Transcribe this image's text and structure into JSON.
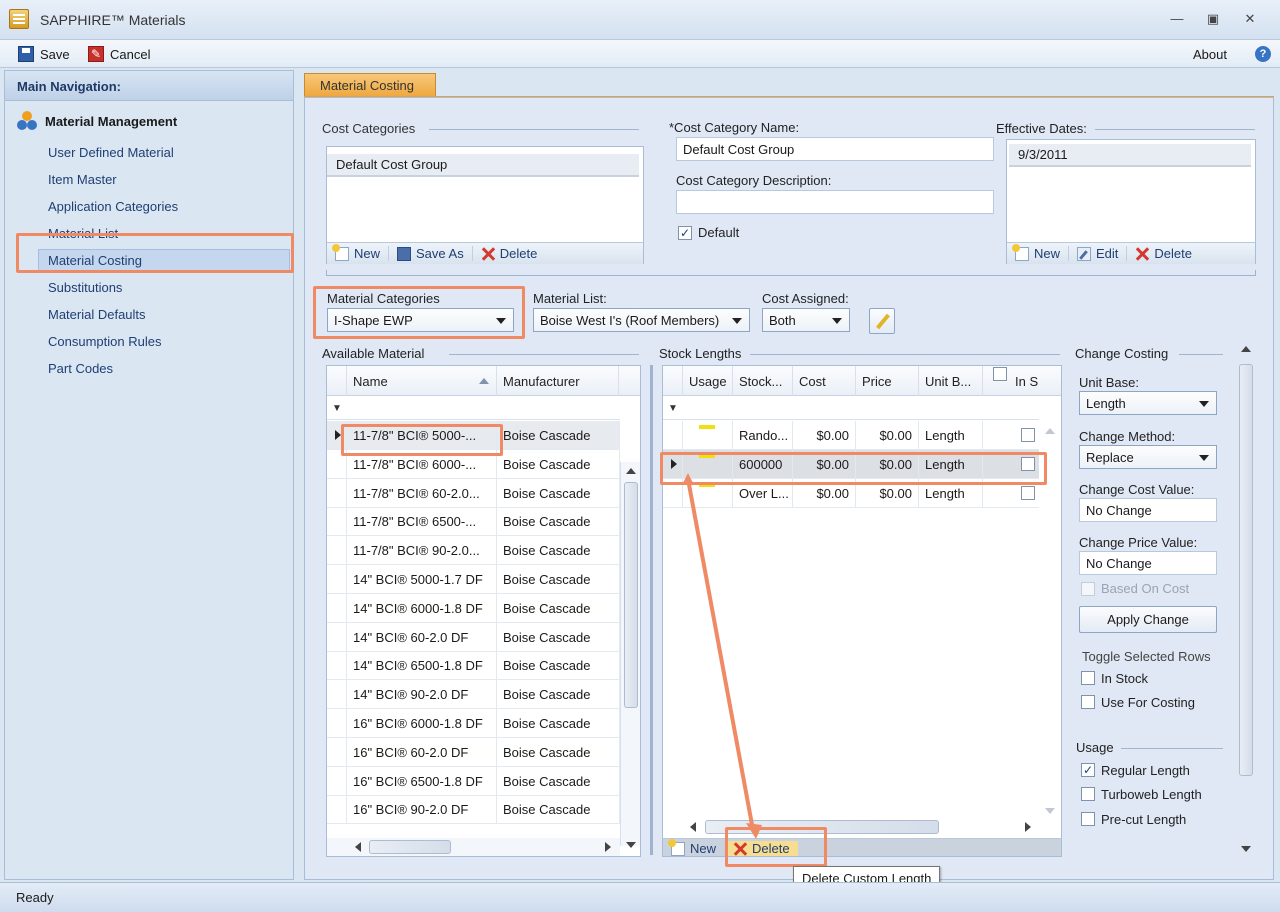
{
  "window": {
    "title": "SAPPHIRE™ Materials"
  },
  "toolbar": {
    "save_label": "Save",
    "cancel_label": "Cancel",
    "about_label": "About"
  },
  "sidebar": {
    "header": "Main Navigation:",
    "section_title": "Material Management",
    "items": [
      {
        "label": "User Defined Material"
      },
      {
        "label": "Item Master"
      },
      {
        "label": "Application Categories"
      },
      {
        "label": "Material List"
      },
      {
        "label": "Material Costing"
      },
      {
        "label": "Substitutions"
      },
      {
        "label": "Material Defaults"
      },
      {
        "label": "Consumption Rules"
      },
      {
        "label": "Part Codes"
      }
    ],
    "selected": "Material Costing"
  },
  "tab": {
    "label": "Material Costing"
  },
  "cost_categories": {
    "label": "Cost Categories",
    "items": [
      "Default Cost Group"
    ],
    "new_label": "New",
    "save_as_label": "Save As",
    "delete_label": "Delete"
  },
  "category_form": {
    "name_label": "*Cost Category Name:",
    "name_value": "Default Cost Group",
    "desc_label": "Cost Category Description:",
    "desc_value": "",
    "default_label": "Default",
    "default_checked": true
  },
  "effective_dates": {
    "label": "Effective Dates:",
    "items": [
      "9/3/2011"
    ],
    "new_label": "New",
    "edit_label": "Edit",
    "delete_label": "Delete"
  },
  "filters": {
    "material_categories_label": "Material Categories",
    "material_categories_value": "I-Shape EWP",
    "material_list_label": "Material List:",
    "material_list_value": "Boise West I's (Roof Members)",
    "cost_assigned_label": "Cost Assigned:",
    "cost_assigned_value": "Both"
  },
  "available_material": {
    "label": "Available Material",
    "columns": [
      "Name",
      "Manufacturer"
    ],
    "rows": [
      [
        "11-7/8\" BCI® 5000-...",
        "Boise Cascade"
      ],
      [
        "11-7/8\" BCI® 6000-...",
        "Boise Cascade"
      ],
      [
        "11-7/8\" BCI® 60-2.0...",
        "Boise Cascade"
      ],
      [
        "11-7/8\" BCI® 6500-...",
        "Boise Cascade"
      ],
      [
        "11-7/8\" BCI® 90-2.0...",
        "Boise Cascade"
      ],
      [
        "14\" BCI® 5000-1.7 DF",
        "Boise Cascade"
      ],
      [
        "14\" BCI® 6000-1.8 DF",
        "Boise Cascade"
      ],
      [
        "14\" BCI® 60-2.0 DF",
        "Boise Cascade"
      ],
      [
        "14\" BCI® 6500-1.8 DF",
        "Boise Cascade"
      ],
      [
        "14\" BCI® 90-2.0 DF",
        "Boise Cascade"
      ],
      [
        "16\" BCI® 6000-1.8 DF",
        "Boise Cascade"
      ],
      [
        "16\" BCI® 60-2.0 DF",
        "Boise Cascade"
      ],
      [
        "16\" BCI® 6500-1.8 DF",
        "Boise Cascade"
      ],
      [
        "16\" BCI® 90-2.0 DF",
        "Boise Cascade"
      ]
    ]
  },
  "stock_lengths": {
    "label": "Stock Lengths",
    "columns": [
      "Usage",
      "Stock...",
      "Cost",
      "Price",
      "Unit B...",
      "In S"
    ],
    "rows": [
      [
        "",
        "Rando...",
        "$0.00",
        "$0.00",
        "Length"
      ],
      [
        "",
        "600000",
        "$0.00",
        "$0.00",
        "Length"
      ],
      [
        "",
        "Over L...",
        "$0.00",
        "$0.00",
        "Length"
      ]
    ],
    "new_label": "New",
    "delete_label": "Delete",
    "tooltip": "Delete Custom Length"
  },
  "change_costing": {
    "label": "Change Costing",
    "unit_base_label": "Unit Base:",
    "unit_base_value": "Length",
    "change_method_label": "Change Method:",
    "change_method_value": "Replace",
    "change_cost_label": "Change Cost Value:",
    "change_cost_value": "No Change",
    "change_price_label": "Change Price Value:",
    "change_price_value": "No Change",
    "based_on_cost_label": "Based On Cost",
    "apply_label": "Apply Change",
    "toggle_label": "Toggle Selected Rows",
    "in_stock_label": "In Stock",
    "use_for_costing_label": "Use For Costing"
  },
  "usage": {
    "label": "Usage",
    "regular_label": "Regular Length",
    "regular_checked": true,
    "turboweb_label": "Turboweb Length",
    "precut_label": "Pre-cut Length"
  },
  "status": {
    "text": "Ready"
  },
  "colors": {
    "highlight": "#f08a64",
    "tab": "#f0ab48",
    "usage_bar": "#f0e010"
  }
}
